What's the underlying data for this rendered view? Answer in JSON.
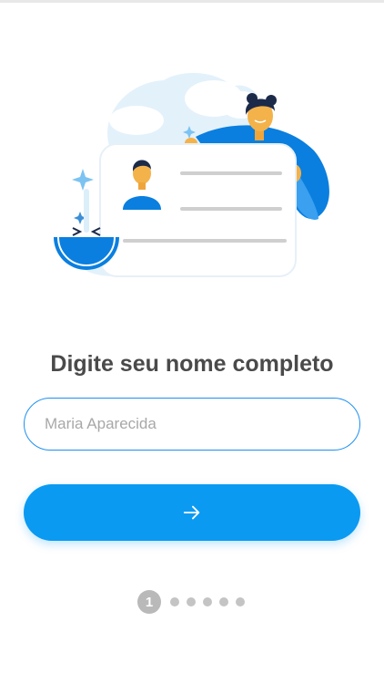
{
  "form": {
    "title": "Digite seu nome completo",
    "name_placeholder": "Maria Aparecida",
    "name_value": "",
    "next_button_icon": "arrow-right-icon"
  },
  "pager": {
    "current_step_label": "1",
    "total_steps": 6,
    "current_step": 1
  },
  "colors": {
    "accent": "#0a9af2",
    "field_border": "#1e90f0",
    "title_text": "#4a4a4a",
    "placeholder_text": "#a8a8a8",
    "pager_inactive": "#c4c4c4",
    "pager_active": "#b9b9b9"
  },
  "illustration": {
    "icon": "id-card-illustration"
  }
}
